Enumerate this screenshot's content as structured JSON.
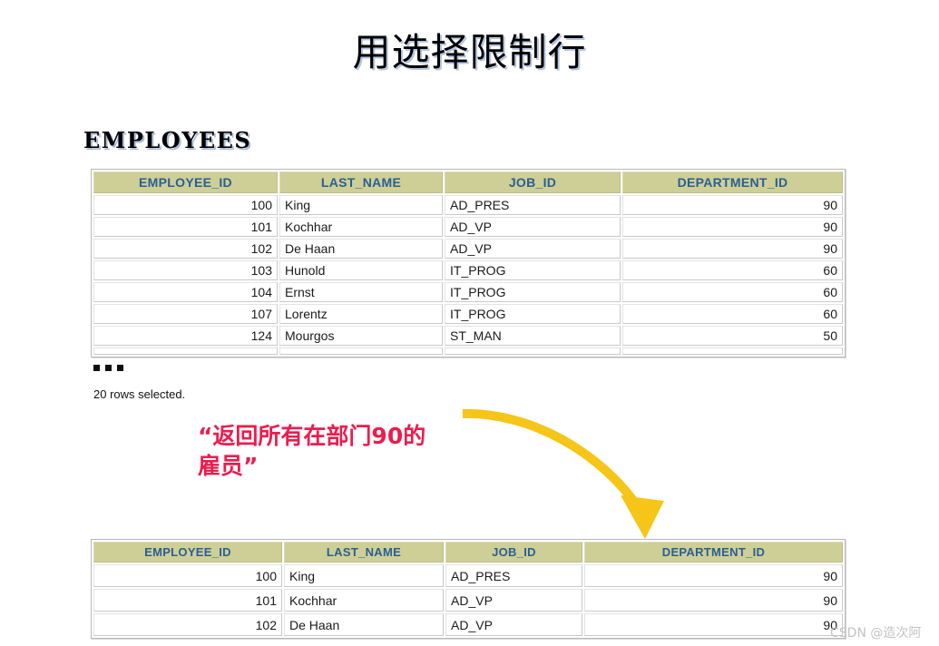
{
  "slide": {
    "title": "用选择限制行",
    "table_label": "EMPLOYEES",
    "rows_selected": "20 rows selected.",
    "ellipsis": "...",
    "callout_line1": "“返回所有在部门90的",
    "callout_line2": "雇员”",
    "watermark": "CSDN @造次阿",
    "colors": {
      "header_bg": "#cdcf97",
      "header_text": "#2c5e93",
      "callout_red": "#ec1c4e",
      "arrow_gold": "#f5c518",
      "watermark_gray": "#c3c3c3"
    }
  },
  "chart_data": {
    "type": "table",
    "title": "EMPLOYEES",
    "tables": [
      {
        "name": "employees-full",
        "columns": [
          "EMPLOYEE_ID",
          "LAST_NAME",
          "JOB_ID",
          "DEPARTMENT_ID"
        ],
        "rows": [
          [
            "100",
            "King",
            "AD_PRES",
            "90"
          ],
          [
            "101",
            "Kochhar",
            "AD_VP",
            "90"
          ],
          [
            "102",
            "De Haan",
            "AD_VP",
            "90"
          ],
          [
            "103",
            "Hunold",
            "IT_PROG",
            "60"
          ],
          [
            "104",
            "Ernst",
            "IT_PROG",
            "60"
          ],
          [
            "107",
            "Lorentz",
            "IT_PROG",
            "60"
          ],
          [
            "124",
            "Mourgos",
            "ST_MAN",
            "50"
          ]
        ],
        "footer": "20 rows selected.",
        "truncated": true
      },
      {
        "name": "employees-filtered-dept-90",
        "columns": [
          "EMPLOYEE_ID",
          "LAST_NAME",
          "JOB_ID",
          "DEPARTMENT_ID"
        ],
        "rows": [
          [
            "100",
            "King",
            "AD_PRES",
            "90"
          ],
          [
            "101",
            "Kochhar",
            "AD_VP",
            "90"
          ],
          [
            "102",
            "De Haan",
            "AD_VP",
            "90"
          ]
        ],
        "footer": "",
        "truncated": false
      }
    ]
  }
}
